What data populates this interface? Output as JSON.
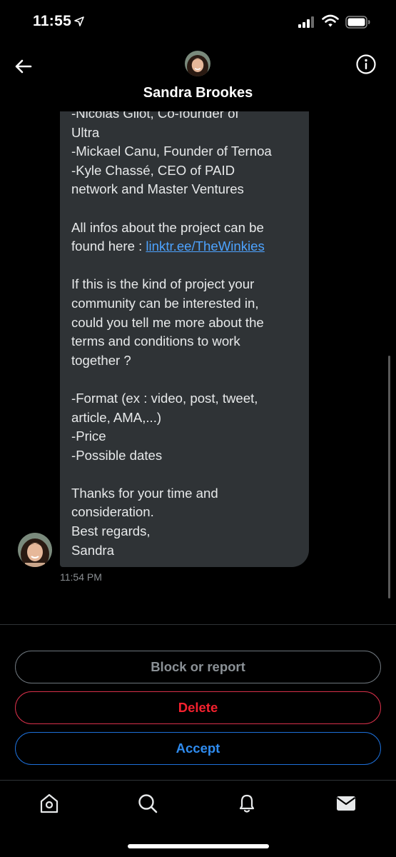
{
  "status_bar": {
    "time": "11:55"
  },
  "header": {
    "contact_name": "Sandra Brookes"
  },
  "message": {
    "text_before_link": "-Nicolas Gilot, Co-founder of\nUltra\n-Mickael Canu, Founder of Ternoa\n-Kyle Chassé, CEO of PAID\nnetwork and Master Ventures\n\nAll infos about the project can be\nfound here : ",
    "link_text": "linktr.ee/TheWinkies",
    "text_after_link": "\n\nIf this is the kind of project your\ncommunity can be interested in,\ncould you tell me more about the\nterms and conditions to work\ntogether ?\n\n-Format (ex : video, post, tweet,\narticle, AMA,...)\n-Price\n-Possible dates\n\nThanks for your time and\nconsideration.\nBest regards,\nSandra",
    "timestamp": "11:54 PM"
  },
  "actions": {
    "block_label": "Block or report",
    "delete_label": "Delete",
    "accept_label": "Accept"
  },
  "tabs": [
    "home-icon",
    "search-icon",
    "notifications-icon",
    "messages-icon"
  ],
  "colors": {
    "bubble": "#2f3336",
    "link": "#4da3ff",
    "delete": "#f4212e",
    "accept": "#2f8cf0"
  }
}
